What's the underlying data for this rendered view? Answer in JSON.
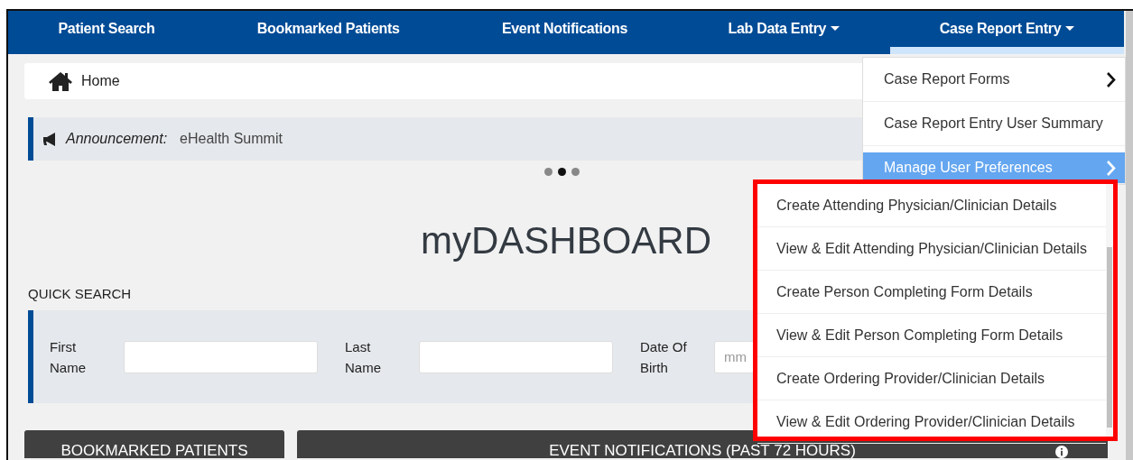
{
  "nav": {
    "items": [
      {
        "label": "Patient Search",
        "dropdown": false,
        "selected": false
      },
      {
        "label": "Bookmarked Patients",
        "dropdown": false,
        "selected": false
      },
      {
        "label": "Event Notifications",
        "dropdown": false,
        "selected": false
      },
      {
        "label": "Lab Data Entry",
        "dropdown": true,
        "selected": false
      },
      {
        "label": "Case Report Entry",
        "dropdown": true,
        "selected": true
      }
    ]
  },
  "breadcrumb": {
    "label": "Home"
  },
  "announcement": {
    "label": "Announcement:",
    "text": "eHealth Summit"
  },
  "carousel": {
    "dots": [
      {
        "selected": false
      },
      {
        "selected": true
      },
      {
        "selected": false
      }
    ]
  },
  "title": "myDASHBOARD",
  "quick_search": {
    "heading": "QUICK SEARCH",
    "fields": [
      {
        "label": "First Name"
      },
      {
        "label": "Last Name"
      },
      {
        "label": "Date Of Birth",
        "placeholder": "mm"
      }
    ]
  },
  "panels": [
    {
      "title": "BOOKMARKED PATIENTS",
      "info": false
    },
    {
      "title": "EVENT NOTIFICATIONS (PAST 72 HOURS)",
      "info": true
    }
  ],
  "dropdown_menu": {
    "items": [
      {
        "label": "Case Report Forms",
        "submenu": true,
        "selected": false
      },
      {
        "label": "Case Report Entry User Summary",
        "submenu": false,
        "selected": false
      },
      {
        "label": "Manage User Preferences",
        "submenu": true,
        "selected": true
      }
    ]
  },
  "submenu": {
    "highlighted": true,
    "items": [
      {
        "label": "Create Attending Physician/Clinician Details"
      },
      {
        "label": "View & Edit Attending Physician/Clinician Details"
      },
      {
        "label": "Create Person Completing Form Details"
      },
      {
        "label": "View & Edit Person Completing Form Details"
      },
      {
        "label": "Create Ordering Provider/Clinician Details"
      },
      {
        "label": "View & Edit Ordering Provider/Clinician Details"
      }
    ]
  }
}
